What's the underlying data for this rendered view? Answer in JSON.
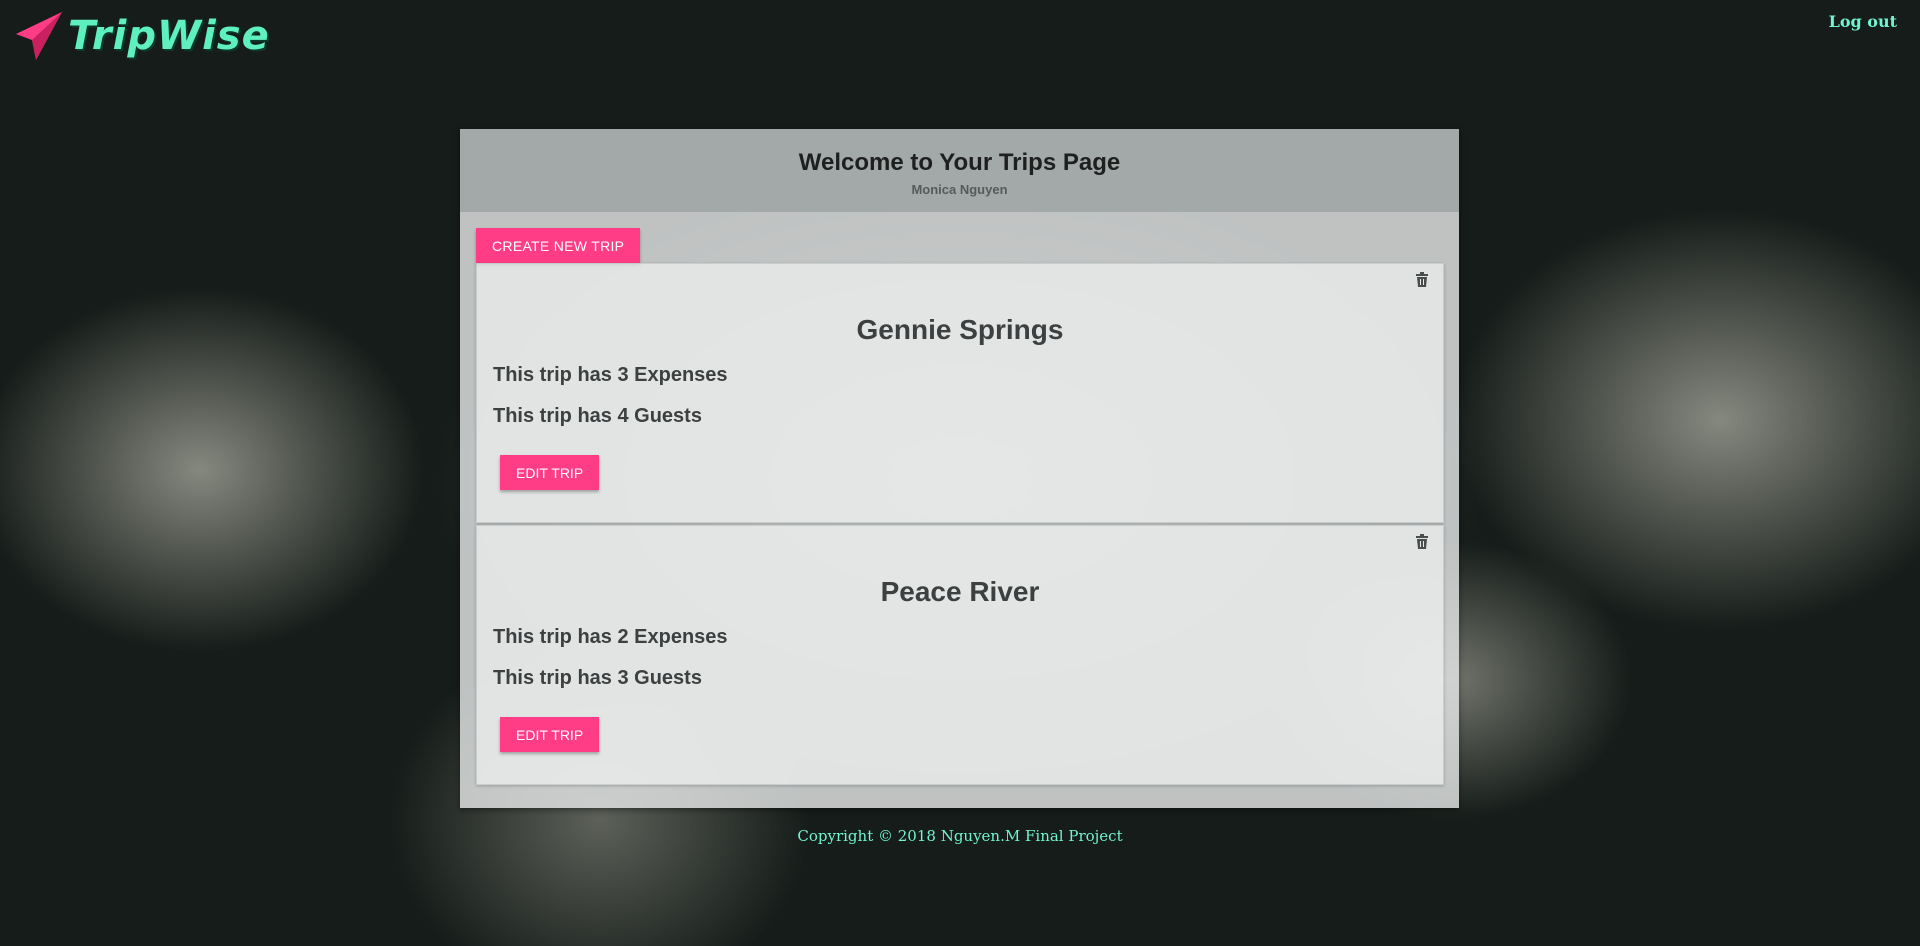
{
  "app": {
    "brand": "TripWise",
    "logo_icon": "paper-plane-icon",
    "logout_label": "Log out"
  },
  "colors": {
    "accent": "#ff3d87",
    "brand": "#5ff0c0",
    "footer_text": "#6ff5cf"
  },
  "header": {
    "title": "Welcome to Your Trips Page",
    "user_name": "Monica Nguyen"
  },
  "actions": {
    "create_label": "CREATE NEW TRIP"
  },
  "trips": [
    {
      "name": "Gennie Springs",
      "expenses_text": "This trip has 3 Expenses",
      "guests_text": "This trip has 4 Guests",
      "edit_label": "EDIT TRIP",
      "delete_icon": "trash-icon"
    },
    {
      "name": "Peace River",
      "expenses_text": "This trip has 2 Expenses",
      "guests_text": "This trip has 3 Guests",
      "edit_label": "EDIT TRIP",
      "delete_icon": "trash-icon"
    }
  ],
  "footer": {
    "copyright": "Copyright © 2018 Nguyen.M Final Project"
  }
}
